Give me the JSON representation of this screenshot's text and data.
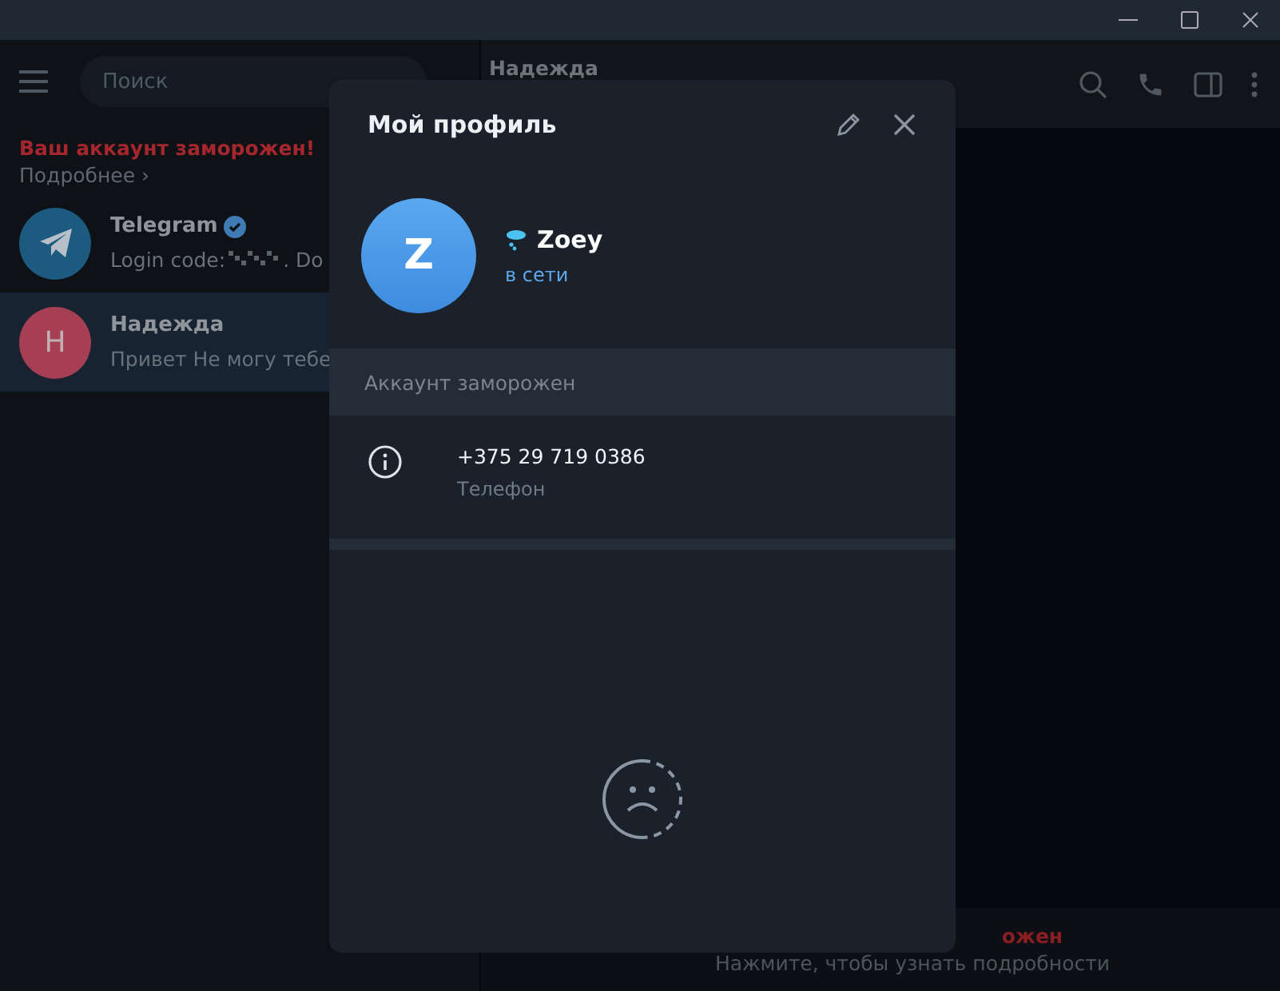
{
  "sidebar": {
    "search": {
      "placeholder": "Поиск"
    },
    "frozen_notice": {
      "title": "Ваш аккаунт заморожен!",
      "link": "Подробнее ›"
    },
    "chats": [
      {
        "kind": "logo",
        "name": "Telegram",
        "verified": true,
        "preview": "Login code:",
        "preview_rest": ". Do",
        "selected": false
      },
      {
        "kind": "letter",
        "name": "Надежда",
        "verified": false,
        "preview": "Привет Не могу тебе",
        "avatar": "Н",
        "selected": true
      }
    ]
  },
  "chat": {
    "title": "Надежда",
    "banner": {
      "title": "ожен",
      "subtitle": "Нажмите, чтобы узнать подробности"
    }
  },
  "profile": {
    "title": "Мой профиль",
    "avatar": "Z",
    "name": "Zoey",
    "status": "в сети",
    "frozen_label": "Аккаунт заморожен",
    "phone": {
      "value": "+375 29 719 0386",
      "label": "Телефон"
    }
  }
}
